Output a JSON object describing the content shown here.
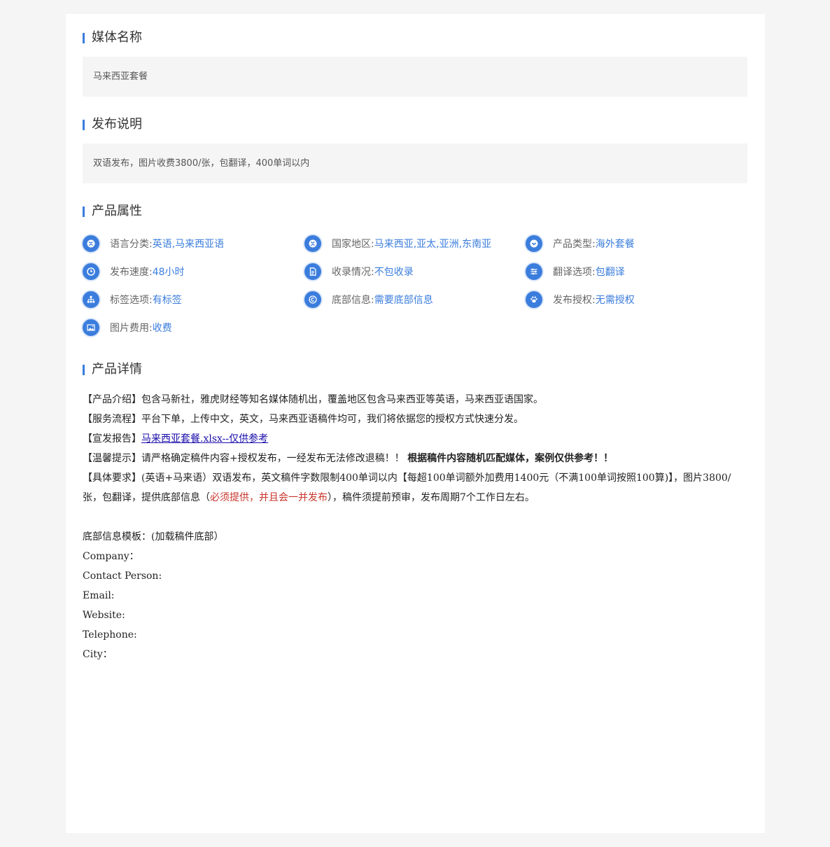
{
  "media_name": {
    "title": "媒体名称",
    "value": "马来西亚套餐"
  },
  "publish_notes": {
    "title": "发布说明",
    "value": "双语发布，图片收费3800/张，包翻译，400单词以内"
  },
  "attributes": {
    "title": "产品属性",
    "items": [
      {
        "icon": "globe-icon",
        "label": "语言分类:",
        "value": "英语,马来西亚语"
      },
      {
        "icon": "globe-icon",
        "label": "国家地区:",
        "value": "马来西亚,亚太,亚洲,东南亚"
      },
      {
        "icon": "chevron-down-circle-icon",
        "label": "产品类型:",
        "value": "海外套餐"
      },
      {
        "icon": "clock-icon",
        "label": "发布速度:",
        "value": "48小时"
      },
      {
        "icon": "document-icon",
        "label": "收录情况:",
        "value": "不包收录"
      },
      {
        "icon": "sliders-icon",
        "label": "翻译选项:",
        "value": "包翻译"
      },
      {
        "icon": "sitemap-icon",
        "label": "标签选项:",
        "value": "有标签"
      },
      {
        "icon": "copyright-icon",
        "label": "底部信息:",
        "value": "需要底部信息"
      },
      {
        "icon": "paw-icon",
        "label": "发布授权:",
        "value": "无需授权"
      },
      {
        "icon": "image-icon",
        "label": "图片费用:",
        "value": "收费"
      }
    ]
  },
  "details": {
    "title": "产品详情",
    "intro": "【产品介绍】包含马新社，雅虎财经等知名媒体随机出，覆盖地区包含马来西亚等英语，马来西亚语国家。",
    "process": "【服务流程】平台下单，上传中文，英文，马来西亚语稿件均可，我们将依据您的授权方式快速分发。",
    "report_prefix": "【宣发报告】",
    "report_link": "马来西亚套餐.xlsx--仅供参考",
    "tips_prefix": "【温馨提示】请严格确定稿件内容+授权发布，一经发布无法修改退稿！！",
    "tips_bold": "根据稿件内容随机匹配媒体，案例仅供参考！！",
    "req_part1": "【具体要求】(英语+马来语）双语发布，英文稿件字数限制400单词以内【每超100单词额外加费用1400元（不满100单词按照100算)】，图片3800/张，包翻译，提供底部信息（",
    "req_red": "必须提供，并且会一并发布",
    "req_part2": "），稿件须提前预审，发布周期7个工作日左右。",
    "footer_template": "底部信息模板：(加载稿件底部）",
    "company": "Company：",
    "contact": "Contact Person:",
    "email": "Email:",
    "website": "Website:",
    "telephone": "Telephone:",
    "city": "City："
  },
  "colors": {
    "accent": "#3b7ddd",
    "red": "#c8352b"
  }
}
